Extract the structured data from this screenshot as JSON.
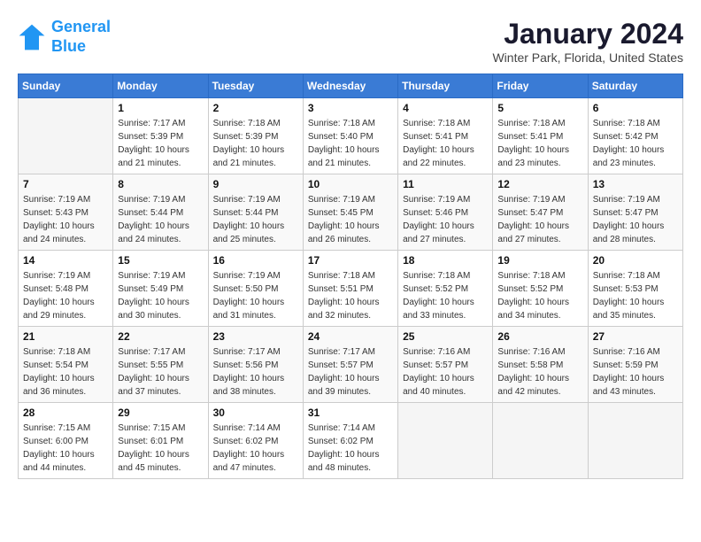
{
  "header": {
    "logo_line1": "General",
    "logo_line2": "Blue",
    "title": "January 2024",
    "subtitle": "Winter Park, Florida, United States"
  },
  "calendar": {
    "days_of_week": [
      "Sunday",
      "Monday",
      "Tuesday",
      "Wednesday",
      "Thursday",
      "Friday",
      "Saturday"
    ],
    "weeks": [
      [
        {
          "day": "",
          "info": ""
        },
        {
          "day": "1",
          "info": "Sunrise: 7:17 AM\nSunset: 5:39 PM\nDaylight: 10 hours\nand 21 minutes."
        },
        {
          "day": "2",
          "info": "Sunrise: 7:18 AM\nSunset: 5:39 PM\nDaylight: 10 hours\nand 21 minutes."
        },
        {
          "day": "3",
          "info": "Sunrise: 7:18 AM\nSunset: 5:40 PM\nDaylight: 10 hours\nand 21 minutes."
        },
        {
          "day": "4",
          "info": "Sunrise: 7:18 AM\nSunset: 5:41 PM\nDaylight: 10 hours\nand 22 minutes."
        },
        {
          "day": "5",
          "info": "Sunrise: 7:18 AM\nSunset: 5:41 PM\nDaylight: 10 hours\nand 23 minutes."
        },
        {
          "day": "6",
          "info": "Sunrise: 7:18 AM\nSunset: 5:42 PM\nDaylight: 10 hours\nand 23 minutes."
        }
      ],
      [
        {
          "day": "7",
          "info": "Sunrise: 7:19 AM\nSunset: 5:43 PM\nDaylight: 10 hours\nand 24 minutes."
        },
        {
          "day": "8",
          "info": "Sunrise: 7:19 AM\nSunset: 5:44 PM\nDaylight: 10 hours\nand 24 minutes."
        },
        {
          "day": "9",
          "info": "Sunrise: 7:19 AM\nSunset: 5:44 PM\nDaylight: 10 hours\nand 25 minutes."
        },
        {
          "day": "10",
          "info": "Sunrise: 7:19 AM\nSunset: 5:45 PM\nDaylight: 10 hours\nand 26 minutes."
        },
        {
          "day": "11",
          "info": "Sunrise: 7:19 AM\nSunset: 5:46 PM\nDaylight: 10 hours\nand 27 minutes."
        },
        {
          "day": "12",
          "info": "Sunrise: 7:19 AM\nSunset: 5:47 PM\nDaylight: 10 hours\nand 27 minutes."
        },
        {
          "day": "13",
          "info": "Sunrise: 7:19 AM\nSunset: 5:47 PM\nDaylight: 10 hours\nand 28 minutes."
        }
      ],
      [
        {
          "day": "14",
          "info": "Sunrise: 7:19 AM\nSunset: 5:48 PM\nDaylight: 10 hours\nand 29 minutes."
        },
        {
          "day": "15",
          "info": "Sunrise: 7:19 AM\nSunset: 5:49 PM\nDaylight: 10 hours\nand 30 minutes."
        },
        {
          "day": "16",
          "info": "Sunrise: 7:19 AM\nSunset: 5:50 PM\nDaylight: 10 hours\nand 31 minutes."
        },
        {
          "day": "17",
          "info": "Sunrise: 7:18 AM\nSunset: 5:51 PM\nDaylight: 10 hours\nand 32 minutes."
        },
        {
          "day": "18",
          "info": "Sunrise: 7:18 AM\nSunset: 5:52 PM\nDaylight: 10 hours\nand 33 minutes."
        },
        {
          "day": "19",
          "info": "Sunrise: 7:18 AM\nSunset: 5:52 PM\nDaylight: 10 hours\nand 34 minutes."
        },
        {
          "day": "20",
          "info": "Sunrise: 7:18 AM\nSunset: 5:53 PM\nDaylight: 10 hours\nand 35 minutes."
        }
      ],
      [
        {
          "day": "21",
          "info": "Sunrise: 7:18 AM\nSunset: 5:54 PM\nDaylight: 10 hours\nand 36 minutes."
        },
        {
          "day": "22",
          "info": "Sunrise: 7:17 AM\nSunset: 5:55 PM\nDaylight: 10 hours\nand 37 minutes."
        },
        {
          "day": "23",
          "info": "Sunrise: 7:17 AM\nSunset: 5:56 PM\nDaylight: 10 hours\nand 38 minutes."
        },
        {
          "day": "24",
          "info": "Sunrise: 7:17 AM\nSunset: 5:57 PM\nDaylight: 10 hours\nand 39 minutes."
        },
        {
          "day": "25",
          "info": "Sunrise: 7:16 AM\nSunset: 5:57 PM\nDaylight: 10 hours\nand 40 minutes."
        },
        {
          "day": "26",
          "info": "Sunrise: 7:16 AM\nSunset: 5:58 PM\nDaylight: 10 hours\nand 42 minutes."
        },
        {
          "day": "27",
          "info": "Sunrise: 7:16 AM\nSunset: 5:59 PM\nDaylight: 10 hours\nand 43 minutes."
        }
      ],
      [
        {
          "day": "28",
          "info": "Sunrise: 7:15 AM\nSunset: 6:00 PM\nDaylight: 10 hours\nand 44 minutes."
        },
        {
          "day": "29",
          "info": "Sunrise: 7:15 AM\nSunset: 6:01 PM\nDaylight: 10 hours\nand 45 minutes."
        },
        {
          "day": "30",
          "info": "Sunrise: 7:14 AM\nSunset: 6:02 PM\nDaylight: 10 hours\nand 47 minutes."
        },
        {
          "day": "31",
          "info": "Sunrise: 7:14 AM\nSunset: 6:02 PM\nDaylight: 10 hours\nand 48 minutes."
        },
        {
          "day": "",
          "info": ""
        },
        {
          "day": "",
          "info": ""
        },
        {
          "day": "",
          "info": ""
        }
      ]
    ]
  }
}
